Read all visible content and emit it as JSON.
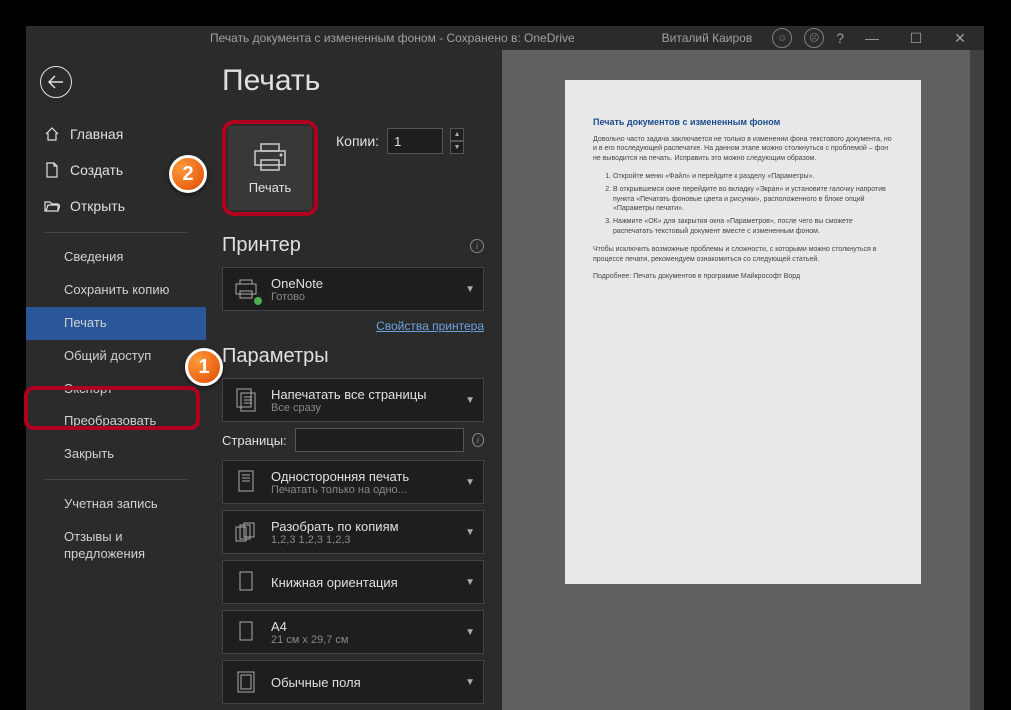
{
  "titlebar": {
    "doc_title": "Печать документа с измененным фоном  -  Сохранено в: OneDrive",
    "user": "Виталий Каиров"
  },
  "sidebar": {
    "home": "Главная",
    "new": "Создать",
    "open": "Открыть",
    "info": "Сведения",
    "save_copy": "Сохранить копию",
    "print": "Печать",
    "share": "Общий доступ",
    "export": "Экспорт",
    "transform": "Преобразовать",
    "close": "Закрыть",
    "account": "Учетная запись",
    "feedback": "Отзывы и предложения"
  },
  "print": {
    "title": "Печать",
    "button_label": "Печать",
    "copies_label": "Копии:",
    "copies_value": "1",
    "printer_header": "Принтер",
    "printer_name": "OneNote",
    "printer_status": "Готово",
    "printer_props": "Свойства принтера",
    "settings_header": "Параметры",
    "pages_label": "Страницы:",
    "options": {
      "all_pages": {
        "title": "Напечатать все страницы",
        "sub": "Все сразу"
      },
      "one_sided": {
        "title": "Односторонняя печать",
        "sub": "Печатать только на одно..."
      },
      "collated": {
        "title": "Разобрать по копиям",
        "sub": "1,2,3    1,2,3    1,2,3"
      },
      "portrait": {
        "title": "Книжная ориентация",
        "sub": ""
      },
      "a4": {
        "title": "A4",
        "sub": "21 см x 29,7 см"
      },
      "margins": {
        "title": "Обычные поля",
        "sub": ""
      }
    }
  },
  "preview": {
    "title": "Печать документов с измененным фоном",
    "para1": "Довольно часто задача заключается не только в изменении фона текстового документа, но и в его последующей распечатке. На данном этапе можно столкнуться с проблемой – фон не выводится на печать. Исправить это можно следующим образом.",
    "li1": "Откройте меню «Файл» и перейдите к разделу «Параметры».",
    "li2": "В открывшемся окне перейдите во вкладку «Экран» и установите галочку напротив пункта «Печатать фоновые цвета и рисунки», расположенного в блоке опций «Параметры печати».",
    "li3": "Нажмите «ОК» для закрытия окна «Параметров», после чего вы сможете распечатать текстовый документ вместе с измененным фоном.",
    "para2": "Чтобы исключить возможные проблемы и сложности, с которыми можно столкнуться в процессе печати, рекомендуем ознакомиться со следующей статьей.",
    "para3": "Подробнее: Печать документов в программе Майкрософт Ворд"
  },
  "badges": {
    "one": "1",
    "two": "2"
  }
}
